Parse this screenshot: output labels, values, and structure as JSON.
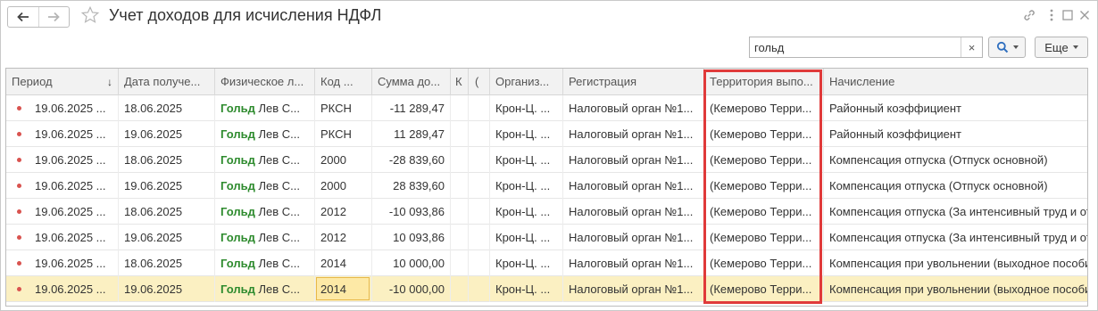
{
  "window": {
    "title": "Учет доходов для исчисления НДФЛ"
  },
  "icons": {
    "back": "back-arrow-icon",
    "forward": "forward-arrow-icon",
    "favorite": "star-icon",
    "link": "link-icon",
    "menu": "more-vertical-icon",
    "maximize": "maximize-icon",
    "close": "close-icon",
    "search": "search-icon",
    "clear": "clear-icon"
  },
  "search": {
    "value": "гольд",
    "clear_label": "×"
  },
  "more_button": {
    "label": "Еще"
  },
  "table": {
    "columns": [
      "Период",
      "Дата получе...",
      "Физическое л...",
      "Код ...",
      "Сумма до...",
      "К",
      "(",
      "Организ...",
      "Регистрация",
      "Территория выпо...",
      "Начисление"
    ],
    "sort_indicator": "↓",
    "rows": [
      {
        "period": "19.06.2025 ...",
        "date": "18.06.2025",
        "person_hl": "Гольд",
        "person_rest": "Лев С...",
        "code": "РКСН",
        "amount": "-11 289,47",
        "org": "Крон-Ц. ...",
        "reg": "Налоговый орган №1...",
        "terr": "(Кемерово Терри...",
        "accrual": "Районный коэффициент"
      },
      {
        "period": "19.06.2025 ...",
        "date": "19.06.2025",
        "person_hl": "Гольд",
        "person_rest": "Лев С...",
        "code": "РКСН",
        "amount": "11 289,47",
        "org": "Крон-Ц. ...",
        "reg": "Налоговый орган №1...",
        "terr": "(Кемерово Терри...",
        "accrual": "Районный коэффициент"
      },
      {
        "period": "19.06.2025 ...",
        "date": "18.06.2025",
        "person_hl": "Гольд",
        "person_rest": "Лев С...",
        "code": "2000",
        "amount": "-28 839,60",
        "org": "Крон-Ц. ...",
        "reg": "Налоговый орган №1...",
        "terr": "(Кемерово Терри...",
        "accrual": "Компенсация отпуска (Отпуск основной)"
      },
      {
        "period": "19.06.2025 ...",
        "date": "19.06.2025",
        "person_hl": "Гольд",
        "person_rest": "Лев С...",
        "code": "2000",
        "amount": "28 839,60",
        "org": "Крон-Ц. ...",
        "reg": "Налоговый орган №1...",
        "terr": "(Кемерово Терри...",
        "accrual": "Компенсация отпуска (Отпуск основной)"
      },
      {
        "period": "19.06.2025 ...",
        "date": "18.06.2025",
        "person_hl": "Гольд",
        "person_rest": "Лев С...",
        "code": "2012",
        "amount": "-10 093,86",
        "org": "Крон-Ц. ...",
        "reg": "Налоговый орган №1...",
        "terr": "(Кемерово Терри...",
        "accrual": "Компенсация отпуска (За интенсивный труд и от"
      },
      {
        "period": "19.06.2025 ...",
        "date": "19.06.2025",
        "person_hl": "Гольд",
        "person_rest": "Лев С...",
        "code": "2012",
        "amount": "10 093,86",
        "org": "Крон-Ц. ...",
        "reg": "Налоговый орган №1...",
        "terr": "(Кемерово Терри...",
        "accrual": "Компенсация отпуска (За интенсивный труд и от"
      },
      {
        "period": "19.06.2025 ...",
        "date": "18.06.2025",
        "person_hl": "Гольд",
        "person_rest": "Лев С...",
        "code": "2014",
        "amount": "10 000,00",
        "org": "Крон-Ц. ...",
        "reg": "Налоговый орган №1...",
        "terr": "(Кемерово Терри...",
        "accrual": "Компенсация при увольнении (выходное пособи"
      },
      {
        "period": "19.06.2025 ...",
        "date": "19.06.2025",
        "person_hl": "Гольд",
        "person_rest": "Лев С...",
        "code": "2014",
        "amount": "-10 000,00",
        "org": "Крон-Ц. ...",
        "reg": "Налоговый орган №1...",
        "terr": "(Кемерово Терри...",
        "accrual": "Компенсация при увольнении (выходное пособи"
      }
    ]
  },
  "colors": {
    "highlight_text": "#2e8b2e",
    "selected_row": "#fbf0c2",
    "annotation_box": "#e03a3a",
    "status_dot": "#d9534f",
    "accent_blue": "#2f6fbf"
  }
}
